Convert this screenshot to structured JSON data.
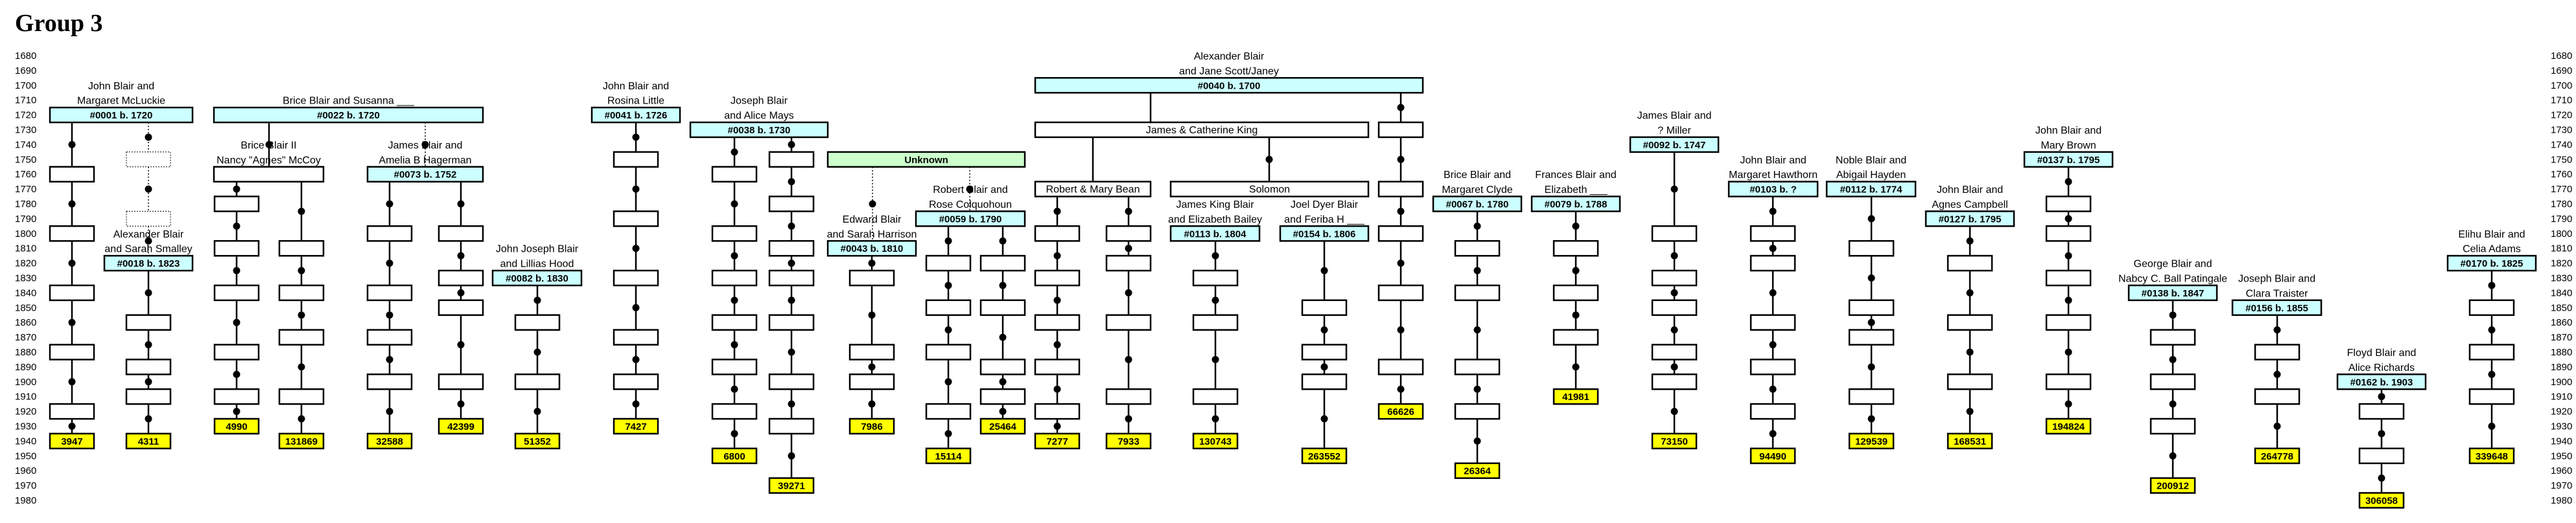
{
  "title": "Group 3",
  "colors": {
    "id_box": "#ccffff",
    "unknown_box": "#ccffcc",
    "total_box": "#ffff00",
    "line": "#000000"
  },
  "years": [
    "1680",
    "1690",
    "1700",
    "1710",
    "1720",
    "1730",
    "1740",
    "1750",
    "1760",
    "1770",
    "1780",
    "1790",
    "1800",
    "1810",
    "1820",
    "1830",
    "1840",
    "1850",
    "1860",
    "1870",
    "1880",
    "1890",
    "1900",
    "1910",
    "1920",
    "1930",
    "1940",
    "1950",
    "1960",
    "1970",
    "1980"
  ],
  "headers": [
    {
      "key": "h0001",
      "text": "#0001 b. 1720",
      "row": 1720,
      "kind": "id",
      "labels": [
        "John Blair and",
        "Margaret McLuckie"
      ]
    },
    {
      "key": "h0018",
      "text": "#0018 b. 1823",
      "row": 1820,
      "kind": "id",
      "labels": [
        "Alexander Blair",
        "and Sarah Smalley"
      ]
    },
    {
      "key": "h0022",
      "text": "#0022 b. 1720",
      "row": 1720,
      "kind": "id",
      "labels": [
        "Brice Blair and Susanna ___"
      ]
    },
    {
      "key": "hBrice2",
      "text": "",
      "row": 1760,
      "kind": "plain",
      "labels": [
        "Brice Blair II",
        "Nancy \"Agnes\" McCoy"
      ]
    },
    {
      "key": "h0073",
      "text": "#0073 b. 1752",
      "row": 1760,
      "kind": "id",
      "labels": [
        "James Blair and",
        "Amelia B Hagerman"
      ]
    },
    {
      "key": "h0082",
      "text": "#0082 b. 1830",
      "row": 1830,
      "kind": "id",
      "labels": [
        "John Joseph Blair",
        "and Lillias Hood"
      ]
    },
    {
      "key": "h0041",
      "text": "#0041 b. 1726",
      "row": 1720,
      "kind": "id",
      "labels": [
        "John Blair and",
        "Rosina Little"
      ]
    },
    {
      "key": "h0038",
      "text": "#0038 b. 1730",
      "row": 1730,
      "kind": "id",
      "labels": [
        "Joseph Blair",
        "and Alice Mays"
      ]
    },
    {
      "key": "hUnknown",
      "text": "Unknown",
      "row": 1750,
      "kind": "unknown",
      "labels": []
    },
    {
      "key": "h0043",
      "text": "#0043 b. 1810",
      "row": 1810,
      "kind": "id",
      "labels": [
        "Edward Blair",
        "and Sarah Harrison"
      ]
    },
    {
      "key": "h0059",
      "text": "#0059 b. 1790",
      "row": 1790,
      "kind": "id",
      "labels": [
        "Robert Blair and",
        "Rose Colquohoun"
      ]
    },
    {
      "key": "h0040",
      "text": "#0040 b. 1700",
      "row": 1700,
      "kind": "id",
      "labels": [
        "Alexander Blair",
        "and Jane Scott/Janey"
      ]
    },
    {
      "key": "hJCK",
      "text": "James & Catherine King",
      "row": 1730,
      "kind": "plain",
      "labels": []
    },
    {
      "key": "hRMB",
      "text": "Robert & Mary Bean",
      "row": 1770,
      "kind": "plain",
      "labels": []
    },
    {
      "key": "hSol",
      "text": "Solomon",
      "row": 1770,
      "kind": "plain",
      "labels": []
    },
    {
      "key": "h0113",
      "text": "#0113 b. 1804",
      "row": 1800,
      "kind": "id",
      "labels": [
        "James King Blair",
        "and Elizabeth Bailey"
      ]
    },
    {
      "key": "h0154",
      "text": "#0154 b. 1806",
      "row": 1800,
      "kind": "id",
      "labels": [
        "Joel Dyer Blair",
        "and Feriba H ___"
      ]
    },
    {
      "key": "h0067",
      "text": "#0067 b. 1780",
      "row": 1780,
      "kind": "id",
      "labels": [
        "Brice Blair and",
        "Margaret Clyde"
      ]
    },
    {
      "key": "h0079",
      "text": "#0079 b. 1788",
      "row": 1780,
      "kind": "id",
      "labels": [
        "Frances Blair and",
        "Elizabeth ___"
      ]
    },
    {
      "key": "h0092",
      "text": "#0092 b. 1747",
      "row": 1740,
      "kind": "id",
      "labels": [
        "James Blair and",
        "? Miller"
      ]
    },
    {
      "key": "h0103",
      "text": "#0103 b. ?",
      "row": 1770,
      "kind": "id",
      "labels": [
        "John Blair and",
        "Margaret Hawthorn"
      ]
    },
    {
      "key": "h0112",
      "text": "#0112 b. 1774",
      "row": 1770,
      "kind": "id",
      "labels": [
        "Noble Blair and",
        "Abigail Hayden"
      ]
    },
    {
      "key": "h0127",
      "text": "#0127 b. 1795",
      "row": 1790,
      "kind": "id",
      "labels": [
        "John Blair and",
        "Agnes Campbell"
      ]
    },
    {
      "key": "h0137",
      "text": "#0137 b. 1795",
      "row": 1750,
      "kind": "id",
      "labels": [
        "John Blair and",
        "Mary Brown"
      ]
    },
    {
      "key": "h0138",
      "text": "#0138 b. 1847",
      "row": 1840,
      "kind": "id",
      "labels": [
        "George Blair and",
        "Nabcy C. Ball Patingale"
      ]
    },
    {
      "key": "h0156",
      "text": "#0156 b. 1855",
      "row": 1850,
      "kind": "id",
      "labels": [
        "Joseph Blair and",
        "Clara Traister"
      ]
    },
    {
      "key": "h0162",
      "text": "#0162 b. 1903",
      "row": 1900,
      "kind": "id",
      "labels": [
        "Floyd Blair and",
        "Alice Richards"
      ]
    },
    {
      "key": "h0170",
      "text": "#0170 b. 1825",
      "row": 1820,
      "kind": "id",
      "labels": [
        "Elihu Blair and",
        "Celia Adams"
      ]
    }
  ],
  "lines": [
    {
      "from": "h0001",
      "boxes": [
        1760,
        1800,
        1840,
        1880,
        1920
      ],
      "total": "3947",
      "total_row": 1940
    },
    {
      "from": "h0001",
      "to": "h0018",
      "style": "dotted",
      "dashed_boxes": [
        1750,
        1790
      ]
    },
    {
      "from": "h0018",
      "boxes": [
        1860,
        1890,
        1910
      ],
      "total": "4311",
      "total_row": 1940
    },
    {
      "from": "h0022",
      "to": "hBrice2"
    },
    {
      "from": "h0022",
      "to": "h0073",
      "style": "dotted"
    },
    {
      "from": "hBrice2",
      "boxes": [
        1780,
        1810,
        1840,
        1880,
        1910
      ],
      "total": "4990",
      "total_row": 1930
    },
    {
      "from": "hBrice2",
      "boxes": [
        1810,
        1840,
        1870,
        1910
      ],
      "total": "131869",
      "total_row": 1940
    },
    {
      "from": "h0073",
      "boxes": [
        1800,
        1840,
        1870,
        1900
      ],
      "total": "32588",
      "total_row": 1940
    },
    {
      "from": "h0073",
      "boxes": [
        1800,
        1830,
        1850,
        1900
      ],
      "total": "42399",
      "total_row": 1930
    },
    {
      "from": "h0082",
      "boxes": [
        1860,
        1900
      ],
      "total": "51352",
      "total_row": 1940
    },
    {
      "from": "h0041",
      "boxes": [
        1750,
        1790,
        1830,
        1870,
        1900
      ],
      "total": "7427",
      "total_row": 1930
    },
    {
      "from": "h0038",
      "boxes": [
        1760,
        1800,
        1830,
        1860,
        1890,
        1920
      ],
      "total": "6800",
      "total_row": 1950
    },
    {
      "from": "h0038",
      "boxes": [
        1750,
        1780,
        1810,
        1830,
        1860,
        1900,
        1930
      ],
      "total": "39271",
      "total_row": 1970
    },
    {
      "from": "hUnknown",
      "to": "h0043",
      "style": "dotted"
    },
    {
      "from": "hUnknown",
      "to": "h0059",
      "style": "dotted"
    },
    {
      "from": "h0043",
      "boxes": [
        1830,
        1880,
        1900
      ],
      "total": "7986",
      "total_row": 1930
    },
    {
      "from": "h0059",
      "boxes": [
        1820,
        1850,
        1880,
        1920
      ],
      "total": "15114",
      "total_row": 1950
    },
    {
      "from": "h0059",
      "boxes": [
        1820,
        1850,
        1890,
        1910
      ],
      "total": "25464",
      "total_row": 1930
    },
    {
      "from": "h0040",
      "to": "hJCK",
      "dot": false
    },
    {
      "from": "hJCK",
      "to": "hRMB",
      "dot": false
    },
    {
      "from": "hJCK",
      "to": "hSol"
    },
    {
      "from": "hRMB",
      "boxes": [
        1800,
        1830,
        1860,
        1890,
        1920
      ],
      "total": "7277",
      "total_row": 1940
    },
    {
      "from": "hRMB",
      "boxes": [
        1800,
        1820,
        1860,
        1910
      ],
      "total": "7933",
      "total_row": 1940
    },
    {
      "from": "h0113",
      "boxes": [
        1830,
        1860,
        1910
      ],
      "total": "130743",
      "total_row": 1940
    },
    {
      "from": "h0154",
      "boxes": [
        1850,
        1880,
        1900
      ],
      "total": "263552",
      "total_row": 1950
    },
    {
      "from": "h0040",
      "boxes": [
        1730,
        1770,
        1800,
        1840,
        1890
      ],
      "total": "66626",
      "total_row": 1920
    },
    {
      "from": "h0067",
      "boxes": [
        1810,
        1840,
        1890,
        1920
      ],
      "total": "26364",
      "total_row": 1960
    },
    {
      "from": "h0079",
      "boxes": [
        1810,
        1840,
        1870
      ],
      "total": "41981",
      "total_row": 1910
    },
    {
      "from": "h0092",
      "boxes": [
        1800,
        1830,
        1850,
        1880,
        1900
      ],
      "total": "73150",
      "total_row": 1940
    },
    {
      "from": "h0103",
      "boxes": [
        1800,
        1820,
        1860,
        1890,
        1920
      ],
      "total": "94490",
      "total_row": 1950
    },
    {
      "from": "h0112",
      "boxes": [
        1810,
        1850,
        1870,
        1910
      ],
      "total": "129539",
      "total_row": 1940
    },
    {
      "from": "h0127",
      "boxes": [
        1820,
        1860,
        1900
      ],
      "total": "168531",
      "total_row": 1940
    },
    {
      "from": "h0137",
      "boxes": [
        1780,
        1800,
        1830,
        1860,
        1900
      ],
      "total": "194824",
      "total_row": 1930
    },
    {
      "from": "h0138",
      "boxes": [
        1870,
        1900,
        1930
      ],
      "total": "200912",
      "total_row": 1970
    },
    {
      "from": "h0156",
      "boxes": [
        1880,
        1910
      ],
      "total": "264778",
      "total_row": 1950
    },
    {
      "from": "h0162",
      "boxes": [
        1920,
        1950
      ],
      "total": "306058",
      "total_row": 1980
    },
    {
      "from": "h0170",
      "boxes": [
        1850,
        1880,
        1910
      ],
      "total": "339648",
      "total_row": 1950
    }
  ]
}
